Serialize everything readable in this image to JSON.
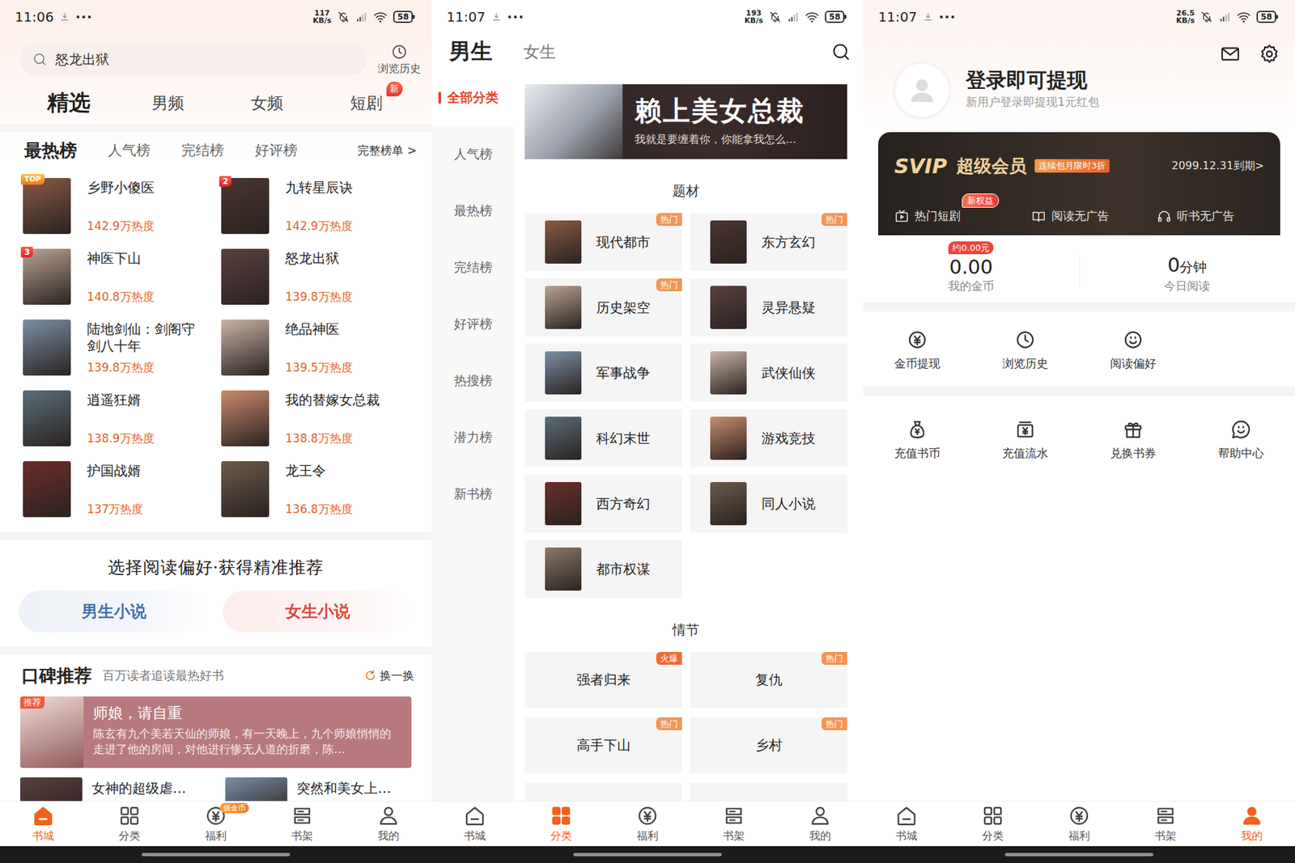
{
  "bookstore": {
    "status_bar": {
      "time": "11:06",
      "dots": "···",
      "speed": "117",
      "speed_unit": "KB/s",
      "battery": "58"
    },
    "search": {
      "placeholder": "怒龙出狱",
      "history": "浏览历史"
    },
    "tabs": [
      {
        "label": "精选",
        "selected": true
      },
      {
        "label": "男频",
        "selected": false
      },
      {
        "label": "女频",
        "selected": false
      },
      {
        "label": "短剧",
        "selected": false,
        "badge": "新"
      }
    ],
    "rank_tabs": [
      {
        "label": "最热榜",
        "selected": true
      },
      {
        "label": "人气榜",
        "selected": false
      },
      {
        "label": "完结榜",
        "selected": false
      },
      {
        "label": "好评榜",
        "selected": false
      }
    ],
    "rank_more": "完整榜单 >",
    "books": [
      {
        "title": "乡野小傻医",
        "heat": "142.9万热度",
        "rank": "TOP"
      },
      {
        "title": "九转星辰诀",
        "heat": "142.9万热度",
        "rank": "2"
      },
      {
        "title": "神医下山",
        "heat": "140.8万热度",
        "rank": "3"
      },
      {
        "title": "怒龙出狱",
        "heat": "139.8万热度"
      },
      {
        "title": "陆地剑仙：剑阁守剑八十年",
        "heat": "139.8万热度"
      },
      {
        "title": "绝品神医",
        "heat": "139.5万热度"
      },
      {
        "title": "逍遥狂婿",
        "heat": "138.9万热度"
      },
      {
        "title": "我的替嫁女总裁",
        "heat": "138.8万热度"
      },
      {
        "title": "护国战婿",
        "heat": "137万热度"
      },
      {
        "title": "龙王令",
        "heat": "136.8万热度"
      }
    ],
    "preference": {
      "title": "选择阅读偏好·获得精准推荐",
      "buttons": [
        {
          "label": "男生小说",
          "color": "#3f6fae"
        },
        {
          "label": "女生小说",
          "color": "#d9483b"
        }
      ]
    },
    "koubei": {
      "title": "口碑推荐",
      "subtitle": "百万读者追读最热好书",
      "refresh": "换一换",
      "featured": {
        "badge": "推荐",
        "title": "师娘，请自重",
        "desc": "陈玄有九个美若天仙的师娘，有一天晚上，九个师娘悄悄的走进了他的房间，对他进行惨无人道的折磨，陈…"
      },
      "more": [
        "女神的超级虐…",
        "突然和美女上…"
      ]
    },
    "bottom_nav": [
      {
        "label": "书城",
        "kind": "home",
        "selected": true
      },
      {
        "label": "分类",
        "kind": "grid",
        "selected": false
      },
      {
        "label": "福利",
        "kind": "coin",
        "selected": false,
        "badge": "领金币"
      },
      {
        "label": "书架",
        "kind": "shelf",
        "selected": false
      },
      {
        "label": "我的",
        "kind": "user",
        "selected": false
      }
    ]
  },
  "category": {
    "status_bar": {
      "time": "11:07",
      "dots": "···",
      "speed": "193",
      "speed_unit": "KB/s",
      "battery": "58"
    },
    "gender_tabs": [
      {
        "label": "男生",
        "selected": true
      },
      {
        "label": "女生",
        "selected": false
      }
    ],
    "sidebar": [
      {
        "label": "全部分类",
        "selected": true
      },
      {
        "label": "人气榜",
        "selected": false
      },
      {
        "label": "最热榜",
        "selected": false
      },
      {
        "label": "完结榜",
        "selected": false
      },
      {
        "label": "好评榜",
        "selected": false
      },
      {
        "label": "热搜榜",
        "selected": false
      },
      {
        "label": "潜力榜",
        "selected": false
      },
      {
        "label": "新书榜",
        "selected": false
      }
    ],
    "banner": {
      "title": "赖上美女总裁",
      "subtitle": "我就是要缠着你，你能拿我怎么..."
    },
    "sections": [
      {
        "title": "题材",
        "kind": "cover",
        "items": [
          {
            "label": "现代都市",
            "badge": "热门",
            "badge_color": "#f39556"
          },
          {
            "label": "东方玄幻",
            "badge": "热门",
            "badge_color": "#f39556"
          },
          {
            "label": "历史架空",
            "badge": "热门",
            "badge_color": "#f39556"
          },
          {
            "label": "灵异悬疑"
          },
          {
            "label": "军事战争"
          },
          {
            "label": "武侠仙侠"
          },
          {
            "label": "科幻末世"
          },
          {
            "label": "游戏竞技"
          },
          {
            "label": "西方奇幻"
          },
          {
            "label": "同人小说"
          },
          {
            "label": "都市权谋"
          }
        ]
      },
      {
        "title": "情节",
        "kind": "text",
        "items": [
          {
            "label": "强者归来",
            "badge": "火爆",
            "badge_color": "#f26a36"
          },
          {
            "label": "复仇",
            "badge": "热门",
            "badge_color": "#f39556"
          },
          {
            "label": "高手下山",
            "badge": "热门",
            "badge_color": "#f39556"
          },
          {
            "label": "乡村",
            "badge": "热门",
            "badge_color": "#f39556"
          }
        ]
      }
    ],
    "bottom_nav": [
      {
        "label": "书城",
        "kind": "home",
        "selected": false
      },
      {
        "label": "分类",
        "kind": "grid",
        "selected": true
      },
      {
        "label": "福利",
        "kind": "coin",
        "selected": false
      },
      {
        "label": "书架",
        "kind": "shelf",
        "selected": false
      },
      {
        "label": "我的",
        "kind": "user",
        "selected": false
      }
    ]
  },
  "profile": {
    "status_bar": {
      "time": "11:07",
      "dots": "···",
      "speed": "26.5",
      "speed_unit": "KB/s",
      "battery": "58"
    },
    "login": {
      "title": "登录即可提现",
      "subtitle": "新用户登录即提现1元红包"
    },
    "svip": {
      "logo": "SVIP",
      "title": "超级会员",
      "promo": "连续包月限时3折",
      "expiry": "2099.12.31到期>",
      "perks": [
        {
          "label": "热门短剧",
          "kind": "tv",
          "badge": "新权益"
        },
        {
          "label": "阅读无广告",
          "kind": "book"
        },
        {
          "label": "听书无广告",
          "kind": "headphones"
        }
      ]
    },
    "stats": [
      {
        "value": "0.00",
        "label": "我的金币",
        "badge": "约0.00元"
      },
      {
        "value": "0",
        "unit": "分钟",
        "label": "今日阅读"
      }
    ],
    "shortcuts": [
      {
        "label": "金币提现",
        "kind": "coin"
      },
      {
        "label": "浏览历史",
        "kind": "clock"
      },
      {
        "label": "阅读偏好",
        "kind": "smile"
      }
    ],
    "services": [
      {
        "label": "充值书币",
        "kind": "bag"
      },
      {
        "label": "充值流水",
        "kind": "bill"
      },
      {
        "label": "兑换书券",
        "kind": "gift"
      },
      {
        "label": "帮助中心",
        "kind": "chat"
      }
    ],
    "bottom_nav": [
      {
        "label": "书城",
        "kind": "home",
        "selected": false
      },
      {
        "label": "分类",
        "kind": "grid",
        "selected": false
      },
      {
        "label": "福利",
        "kind": "coin",
        "selected": false
      },
      {
        "label": "书架",
        "kind": "shelf",
        "selected": false
      },
      {
        "label": "我的",
        "kind": "user",
        "selected": true
      }
    ]
  }
}
